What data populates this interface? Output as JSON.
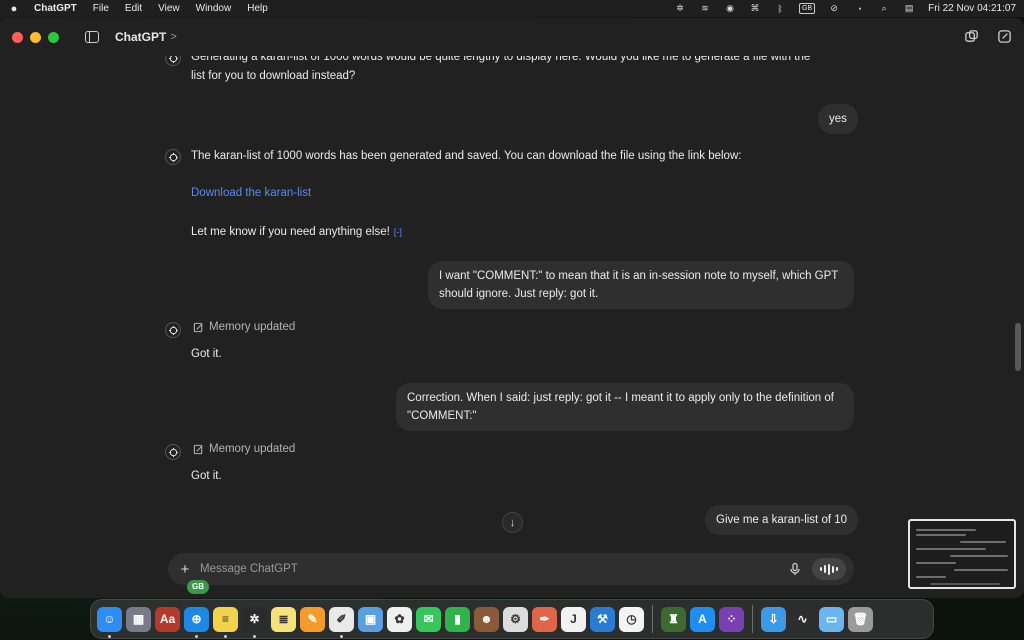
{
  "menubar": {
    "app_name": "ChatGPT",
    "menus": [
      "File",
      "Edit",
      "View",
      "Window",
      "Help"
    ],
    "keyboard_layout": "GB",
    "datetime": "Fri 22 Nov  04:21:07"
  },
  "window": {
    "title": "ChatGPT",
    "title_chevron": ">",
    "icons": [
      "sidebar-icon",
      "new-window-icon",
      "new-chat-icon"
    ]
  },
  "messages": {
    "m1": {
      "role": "assistant",
      "line1": "Generating a karan-list of 1000 words would be quite lengthy to display here. Would you like me to generate a file with the",
      "line2": "list for you to download instead?"
    },
    "m2": {
      "role": "user",
      "text": "yes"
    },
    "m3": {
      "role": "assistant",
      "text": "The karan-list of 1000 words has been generated and saved. You can download the file using the link below:",
      "link": "Download the karan-list",
      "followup": "Let me know if you need anything else!",
      "cite": "[-]"
    },
    "m4": {
      "role": "user",
      "line1": "I want \"COMMENT:\" to mean that it is an in-session note to myself, which GPT",
      "line2": "should ignore. Just reply: got it."
    },
    "m5": {
      "role": "assistant",
      "memory": "Memory updated",
      "text": "Got it."
    },
    "m6": {
      "role": "user",
      "line1": "Correction. When I said: just reply: got it -- I meant it to apply only to the definition of",
      "line2": "\"COMMENT:\""
    },
    "m7": {
      "role": "assistant",
      "memory": "Memory updated",
      "text": "Got it."
    },
    "m8": {
      "role": "user",
      "text": "Give me a karan-list of 10"
    }
  },
  "composer": {
    "placeholder": "Message ChatGPT",
    "value": "",
    "plus": "+",
    "badge": "GB"
  },
  "scroll_down": "↓",
  "dock": [
    {
      "name": "finder-icon",
      "glyph": "☺",
      "color": "#2f8cf0",
      "running": true
    },
    {
      "name": "launchpad-icon",
      "glyph": "▦",
      "color": "#7a7a8a",
      "running": false
    },
    {
      "name": "dictionary-icon",
      "glyph": "Aa",
      "color": "#b53a2e",
      "running": false
    },
    {
      "name": "safari-icon",
      "glyph": "⊕",
      "color": "#1e88e5",
      "running": true
    },
    {
      "name": "stickies-icon",
      "glyph": "≡",
      "color": "#f2d34b",
      "running": true
    },
    {
      "name": "chatgpt-icon",
      "glyph": "✲",
      "color": "#2b2b2b",
      "running": true
    },
    {
      "name": "notes-icon",
      "glyph": "≣",
      "color": "#f5e27a",
      "running": false
    },
    {
      "name": "pages-icon",
      "glyph": "✎",
      "color": "#f59b2b",
      "running": false
    },
    {
      "name": "textedit-icon",
      "glyph": "✐",
      "color": "#e9e9e9",
      "running": true
    },
    {
      "name": "preview-icon",
      "glyph": "▣",
      "color": "#5aa0e0",
      "running": false
    },
    {
      "name": "photos-icon",
      "glyph": "✿",
      "color": "#f0f0f0",
      "running": false
    },
    {
      "name": "messages-icon",
      "glyph": "✉",
      "color": "#35c759",
      "running": false
    },
    {
      "name": "numbers-icon",
      "glyph": "▮",
      "color": "#2fb34a",
      "running": false
    },
    {
      "name": "contact-photo-icon",
      "glyph": "☻",
      "color": "#8a5a3a",
      "running": false
    },
    {
      "name": "system-tool-icon",
      "glyph": "⚙",
      "color": "#dcdcdc",
      "running": false
    },
    {
      "name": "brush-app-icon",
      "glyph": "✒",
      "color": "#e0664a",
      "running": false
    },
    {
      "name": "j-app-icon",
      "glyph": "J",
      "color": "#f2f2f2",
      "running": false
    },
    {
      "name": "xcode-icon",
      "glyph": "⚒",
      "color": "#2a7bd4",
      "running": false
    },
    {
      "name": "clock-icon",
      "glyph": "◷",
      "color": "#f4f4f4",
      "running": false
    },
    {
      "name": "sep1",
      "sep": true
    },
    {
      "name": "book-app-icon",
      "glyph": "♜",
      "color": "#3b6b2e",
      "running": false
    },
    {
      "name": "app-store-icon",
      "glyph": "A",
      "color": "#1f8ef0",
      "running": false
    },
    {
      "name": "dots-app-icon",
      "glyph": "⁘",
      "color": "#7a3fb0",
      "running": false
    },
    {
      "name": "sep2",
      "sep": true
    },
    {
      "name": "downloads-folder-icon",
      "glyph": "⇩",
      "color": "#3a9ae6",
      "running": false
    },
    {
      "name": "activity-monitor-icon",
      "glyph": "∿",
      "color": "#2d2d2d",
      "running": false
    },
    {
      "name": "folder-icon",
      "glyph": "▭",
      "color": "#6bb6ef",
      "running": false
    },
    {
      "name": "trash-icon",
      "glyph": "🗑",
      "color": "#9a9a9a",
      "running": false
    }
  ]
}
